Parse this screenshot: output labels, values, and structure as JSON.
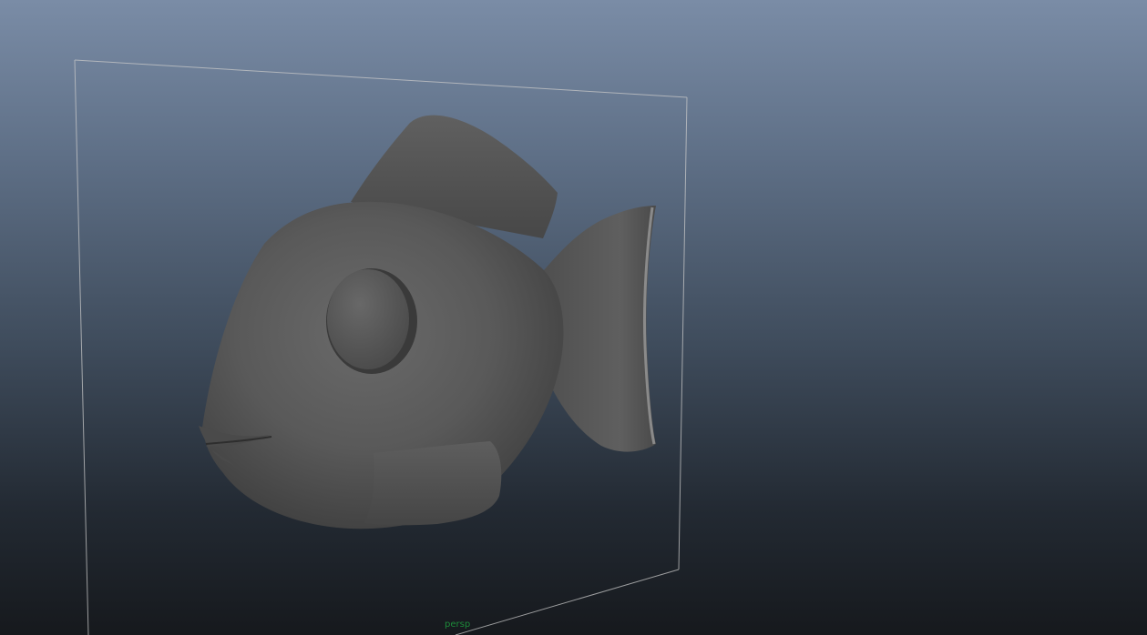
{
  "viewport": {
    "camera_name": "persp",
    "background_top": "#7a8ca6",
    "background_bottom": "#16191d"
  },
  "scene": {
    "object": "fish-model",
    "object_color": "#5a5a5a",
    "frame_color": "#c8c8c8"
  },
  "colors": {
    "camera_label": "#1d8a3a"
  }
}
